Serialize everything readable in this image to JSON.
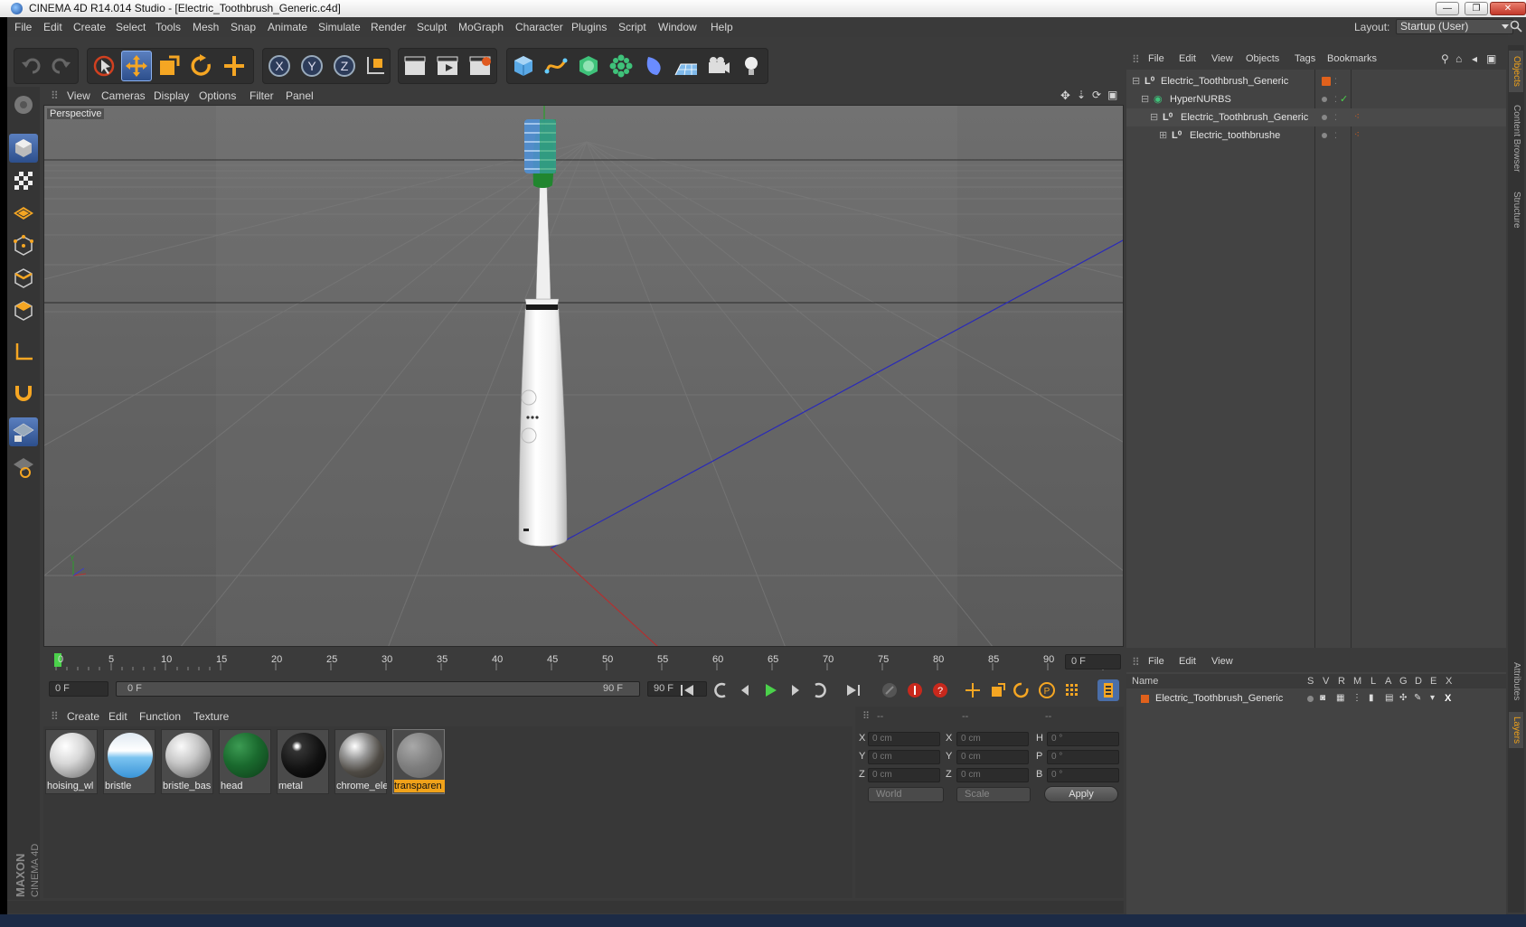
{
  "window": {
    "title": "CINEMA 4D R14.014 Studio - [Electric_Toothbrush_Generic.c4d]",
    "min": "—",
    "max": "❐",
    "close": "✕"
  },
  "menubar": {
    "items": [
      "File",
      "Edit",
      "Create",
      "Select",
      "Tools",
      "Mesh",
      "Snap",
      "Animate",
      "Simulate",
      "Render",
      "Sculpt",
      "MoGraph",
      "Character",
      "Plugins",
      "Script",
      "Window",
      "Help"
    ],
    "layout_label": "Layout:",
    "layout_value": "Startup (User)"
  },
  "viewport": {
    "menu": [
      "View",
      "Cameras",
      "Display",
      "Options",
      "Filter",
      "Panel"
    ],
    "label": "Perspective"
  },
  "timeline": {
    "ticks": [
      "0",
      "5",
      "10",
      "15",
      "20",
      "25",
      "30",
      "35",
      "40",
      "45",
      "50",
      "55",
      "60",
      "65",
      "70",
      "75",
      "80",
      "85",
      "90"
    ],
    "current_frame": "0 F"
  },
  "timecontrols": {
    "start": "0 F",
    "range_start": "0 F",
    "range_end": "90 F",
    "end": "90 F"
  },
  "materials": {
    "menu": [
      "Create",
      "Edit",
      "Function",
      "Texture"
    ],
    "items": [
      {
        "name": "hoising_wl"
      },
      {
        "name": "bristle"
      },
      {
        "name": "bristle_bas"
      },
      {
        "name": "head"
      },
      {
        "name": "metal"
      },
      {
        "name": "chrome_ele"
      },
      {
        "name": "transparen"
      }
    ]
  },
  "attributes": {
    "col1": "--",
    "col2": "--",
    "col3": "--",
    "x_label": "X",
    "y_label": "Y",
    "z_label": "Z",
    "h_label": "H",
    "p_label": "P",
    "b_label": "B",
    "pos_x": "0 cm",
    "pos_y": "0 cm",
    "pos_z": "0 cm",
    "size_x": "0 cm",
    "size_y": "0 cm",
    "size_z": "0 cm",
    "rot_h": "0 °",
    "rot_p": "0 °",
    "rot_b": "0 °",
    "world": "World",
    "scale": "Scale",
    "apply": "Apply"
  },
  "objects": {
    "menu": [
      "File",
      "Edit",
      "View",
      "Objects",
      "Tags",
      "Bookmarks"
    ],
    "rows": [
      {
        "name": "Electric_Toothbrush_Generic"
      },
      {
        "name": "HyperNURBS"
      },
      {
        "name": "Electric_Toothbrush_Generic"
      },
      {
        "name": "Electric_toothbrushe"
      }
    ]
  },
  "layers": {
    "menu": [
      "File",
      "Edit",
      "View"
    ],
    "header": {
      "name": "Name",
      "cols": [
        "S",
        "V",
        "R",
        "M",
        "L",
        "A",
        "G",
        "D",
        "E",
        "X"
      ]
    },
    "rows": [
      {
        "name": "Electric_Toothbrush_Generic"
      }
    ]
  },
  "righttabs": [
    "Objects",
    "Content Browser",
    "Structure",
    "Attributes",
    "Layers"
  ],
  "brand": {
    "maxon": "MAXON",
    "cinema": "CINEMA 4D"
  },
  "colors": {
    "accent": "#f0a21a",
    "selected": "#3f66a8",
    "bg": "#3b3b3b"
  }
}
